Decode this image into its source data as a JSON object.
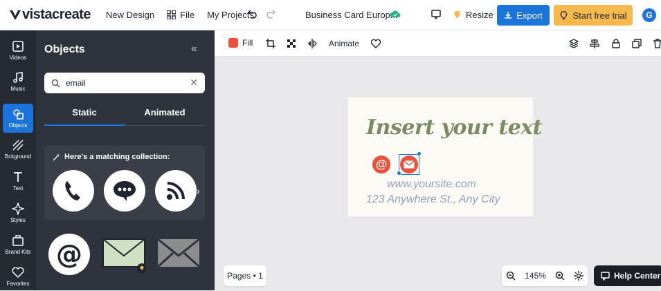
{
  "header": {
    "logo": "vistacreate",
    "new_design": "New Design",
    "file": "File",
    "my_projects": "My Projects",
    "doc_title": "Business Card Europ...",
    "resize": "Resize",
    "export": "Export",
    "start_trial": "Start free trial",
    "avatar_letter": "G"
  },
  "rail": [
    {
      "label": "Videos",
      "icon": "video-icon"
    },
    {
      "label": "Music",
      "icon": "music-icon"
    },
    {
      "label": "Objects",
      "icon": "objects-icon"
    },
    {
      "label": "Bckground",
      "icon": "background-icon"
    },
    {
      "label": "Text",
      "icon": "text-icon"
    },
    {
      "label": "Styles",
      "icon": "styles-icon"
    },
    {
      "label": "Brand Kits",
      "icon": "brand-kit-icon"
    },
    {
      "label": "Favorites",
      "icon": "heart-icon"
    }
  ],
  "panel": {
    "title": "Objects",
    "search_value": "email",
    "tabs": [
      "Static",
      "Animated"
    ],
    "collection_title": "Here's a matching collection:"
  },
  "toolbar": {
    "fill": "Fill",
    "animate": "Animate"
  },
  "card": {
    "heading": "Insert your text",
    "site": "www.yoursite.com",
    "address": "123 Anywhere St., Any City"
  },
  "footer": {
    "pages": "Pages • 1",
    "zoom": "145%",
    "help": "Help Center"
  },
  "colors": {
    "accent": "#1b74d9",
    "trial": "#f6b94d",
    "fill": "#e8523a",
    "heading": "#7a8c63",
    "subtext": "#9a9fbd"
  }
}
